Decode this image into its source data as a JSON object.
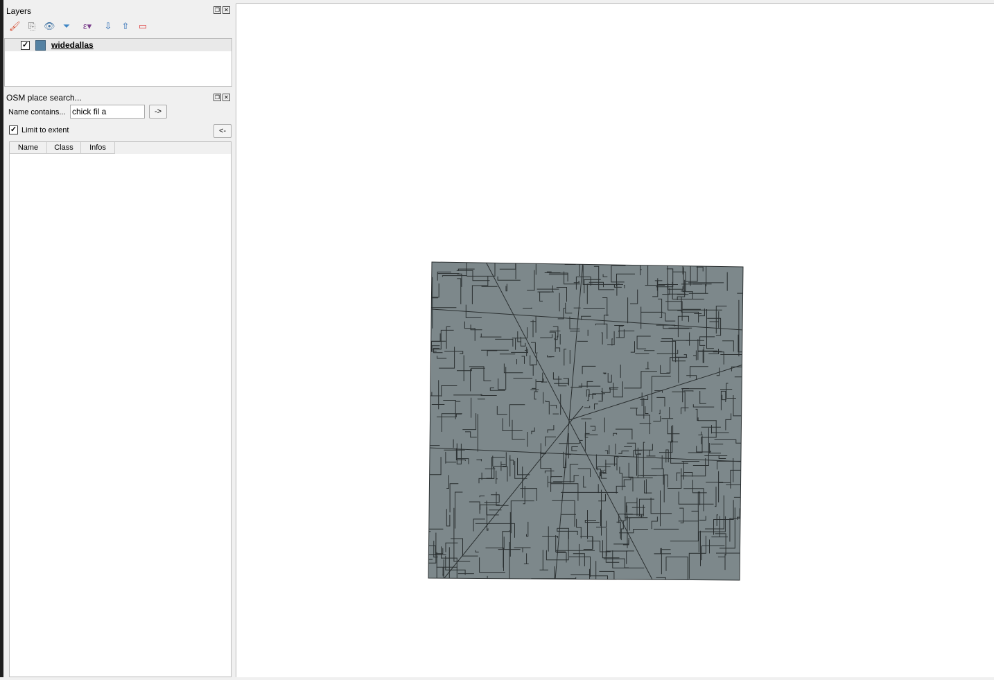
{
  "layers_panel": {
    "title": "Layers",
    "toolbar": [
      "style-brush-icon",
      "add-group-icon",
      "visibility-eye-icon",
      "filter-icon",
      "expression-filter-icon",
      "expand-all-icon",
      "collapse-all-icon",
      "remove-layer-icon"
    ],
    "layers": [
      {
        "name": "widedallas",
        "checked": true,
        "color": "#5582a3"
      }
    ]
  },
  "osm_panel": {
    "title": "OSM place search...",
    "name_label": "Name contains...",
    "name_value": "chick fil a",
    "go_label": "->",
    "limit_label": "Limit to extent",
    "limit_checked": true,
    "back_label": "<-",
    "columns": [
      "Name",
      "Class",
      "Infos"
    ]
  },
  "map": {
    "fill": "#7d888b",
    "stroke": "#2a2f30"
  }
}
